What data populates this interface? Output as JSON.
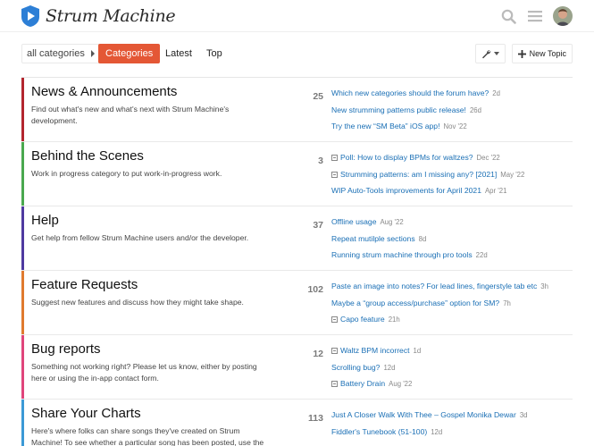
{
  "app": {
    "title": "Strum Machine",
    "colors": {
      "accent": "#e45735",
      "link": "#1a6fb5",
      "logo": "#2d7fd6"
    }
  },
  "header": {
    "icons": [
      "search-icon",
      "menu-icon",
      "avatar"
    ]
  },
  "nav": {
    "category_dropdown": "all categories",
    "tabs": [
      {
        "label": "Categories",
        "active": true
      },
      {
        "label": "Latest",
        "active": false
      },
      {
        "label": "Top",
        "active": false
      }
    ],
    "new_topic": "New Topic"
  },
  "categories": [
    {
      "name": "News & Announcements",
      "description": "Find out what's new and what's next with Strum Machine's development.",
      "color": "#b3262e",
      "count": "25",
      "topics": [
        {
          "title": "Which new categories should the forum have?",
          "age": "2d",
          "locked": false
        },
        {
          "title": "New strumming patterns public release!",
          "age": "26d",
          "locked": false
        },
        {
          "title": "Try the new “SM Beta” iOS app!",
          "age": "Nov '22",
          "locked": false
        }
      ]
    },
    {
      "name": "Behind the Scenes",
      "description": "Work in progress category to put work-in-progress work.",
      "color": "#4aa84f",
      "count": "3",
      "topics": [
        {
          "title": "Poll: How to display BPMs for waltzes?",
          "age": "Dec '22",
          "locked": true
        },
        {
          "title": "Strumming patterns: am I missing any? [2021]",
          "age": "May '22",
          "locked": true
        },
        {
          "title": "WIP Auto-Tools improvements for April 2021",
          "age": "Apr '21",
          "locked": false
        }
      ]
    },
    {
      "name": "Help",
      "description": "Get help from fellow Strum Machine users and/or the developer.",
      "color": "#4f3aa0",
      "count": "37",
      "topics": [
        {
          "title": "Offline usage",
          "age": "Aug '22",
          "locked": false
        },
        {
          "title": "Repeat mutilple sections",
          "age": "8d",
          "locked": false
        },
        {
          "title": "Running strum machine through pro tools",
          "age": "22d",
          "locked": false
        }
      ]
    },
    {
      "name": "Feature Requests",
      "description": "Suggest new features and discuss how they might take shape.",
      "color": "#e07a2e",
      "count": "102",
      "topics": [
        {
          "title": "Paste an image into notes? For lead lines, fingerstyle tab etc",
          "age": "3h",
          "locked": false
        },
        {
          "title": "Maybe a “group access/purchase” option for SM?",
          "age": "7h",
          "locked": false
        },
        {
          "title": "Capo feature",
          "age": "21h",
          "locked": true
        }
      ]
    },
    {
      "name": "Bug reports",
      "description": "Something not working right? Please let us know, either by posting here or using the in-app contact form.",
      "color": "#e0457b",
      "count": "12",
      "topics": [
        {
          "title": "Waltz BPM incorrect",
          "age": "1d",
          "locked": true
        },
        {
          "title": "Scrolling bug?",
          "age": "12d",
          "locked": false
        },
        {
          "title": "Battery Drain",
          "age": "Aug '22",
          "locked": true
        }
      ]
    },
    {
      "name": "Share Your Charts",
      "description": "Here's where folks can share songs they've created on Strum Machine! To see whether a particular song has been posted, use the magnifying",
      "color": "#3c9ad6",
      "count": "113",
      "topics": [
        {
          "title": "Just A Closer Walk With Thee – Gospel Monika Dewar",
          "age": "3d",
          "locked": false
        },
        {
          "title": "Fiddler's Tunebook (51-100)",
          "age": "12d",
          "locked": false
        },
        {
          "title": "",
          "age": "",
          "locked": false
        }
      ]
    }
  ]
}
